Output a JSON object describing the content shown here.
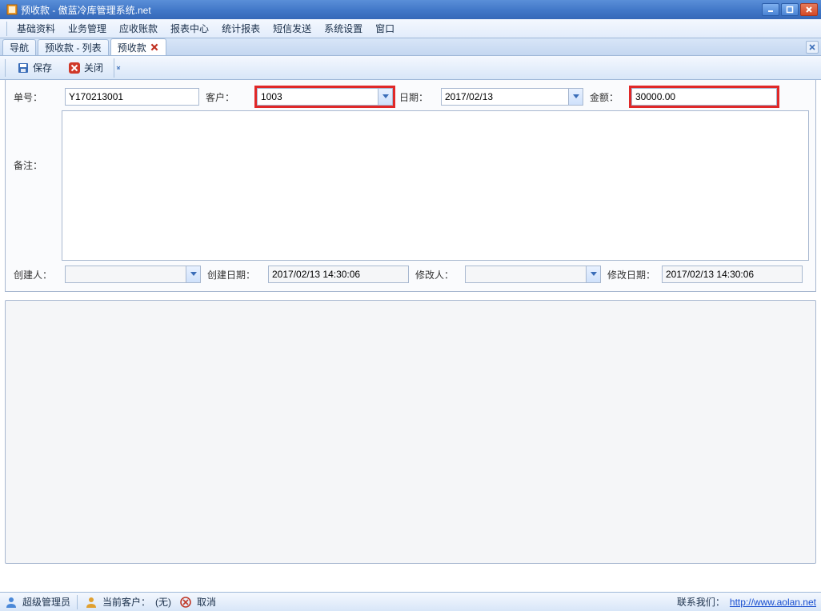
{
  "window": {
    "title": "预收款 - 傲蓝冷库管理系统.net"
  },
  "menu": {
    "items": [
      "基础资料",
      "业务管理",
      "应收账款",
      "报表中心",
      "统计报表",
      "短信发送",
      "系统设置",
      "窗口"
    ]
  },
  "tabs": {
    "items": [
      {
        "label": "导航",
        "closable": false
      },
      {
        "label": "预收款 - 列表",
        "closable": false
      },
      {
        "label": "预收款",
        "closable": true,
        "active": true
      }
    ]
  },
  "toolbar": {
    "save": "保存",
    "close": "关闭"
  },
  "form": {
    "doc_no_label": "单号：",
    "doc_no": "Y170213001",
    "customer_label": "客户：",
    "customer": "1003",
    "date_label": "日期：",
    "date": "2017/02/13",
    "amount_label": "金额：",
    "amount": "30000.00",
    "remark_label": "备注：",
    "remark": "",
    "creator_label": "创建人：",
    "creator": "",
    "create_date_label": "创建日期：",
    "create_date": "2017/02/13 14:30:06",
    "modifier_label": "修改人：",
    "modifier": "",
    "modify_date_label": "修改日期：",
    "modify_date": "2017/02/13 14:30:06"
  },
  "status": {
    "user": "超级管理员",
    "cur_cust_label": "当前客户：",
    "cur_cust_value": "(无)",
    "cancel": "取消",
    "contact_label": "联系我们：",
    "contact_url": "http://www.aolan.net"
  }
}
